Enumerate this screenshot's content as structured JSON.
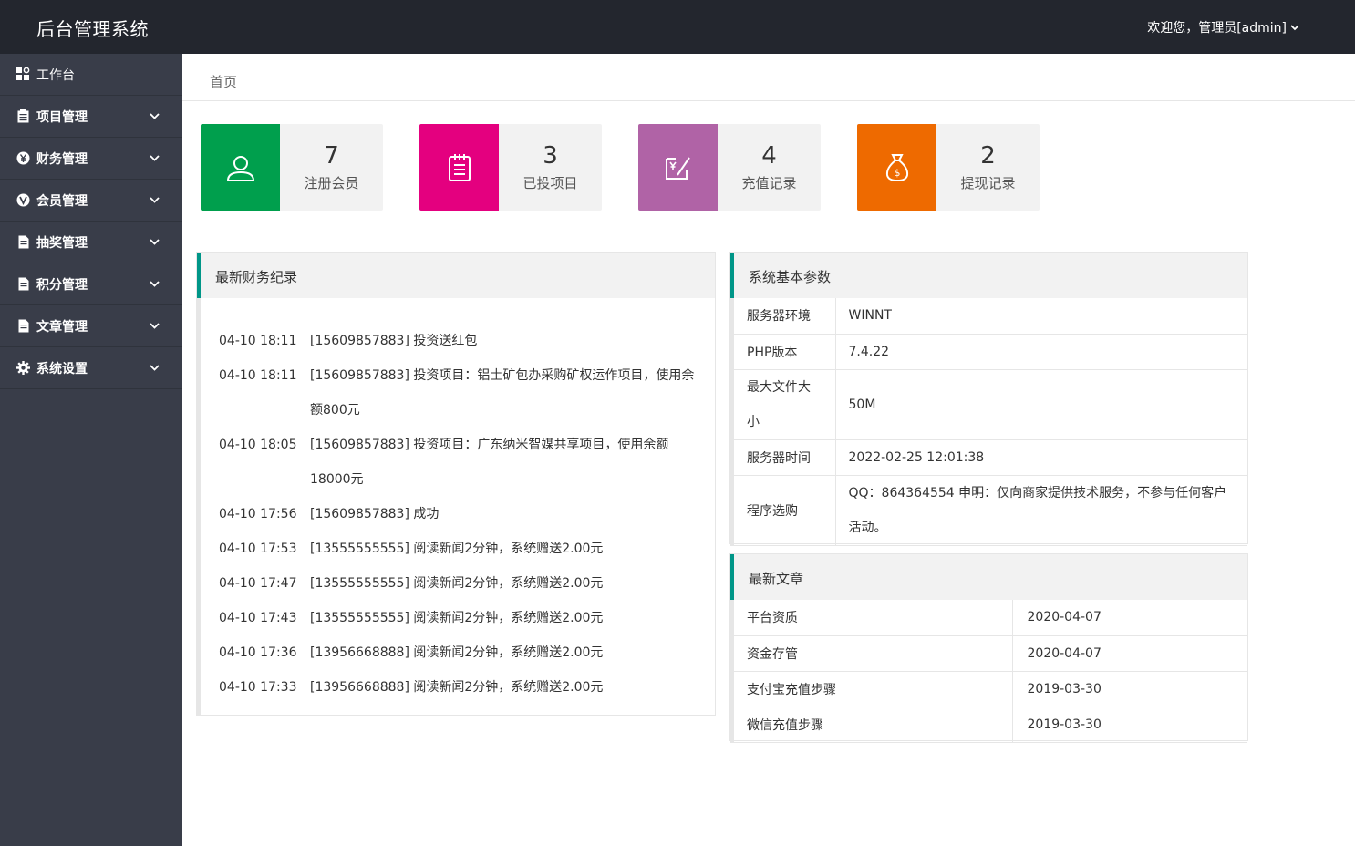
{
  "app": {
    "title": "后台管理系统",
    "user_menu_label": "欢迎您，管理员[admin]"
  },
  "sidebar": {
    "items": [
      {
        "label": "工作台",
        "icon": "dashboard-icon"
      },
      {
        "label": "项目管理",
        "icon": "clipboard-icon"
      },
      {
        "label": "财务管理",
        "icon": "yen-icon"
      },
      {
        "label": "会员管理",
        "icon": "member-v-icon"
      },
      {
        "label": "抽奖管理",
        "icon": "document-icon"
      },
      {
        "label": "积分管理",
        "icon": "document-icon"
      },
      {
        "label": "文章管理",
        "icon": "document-icon"
      },
      {
        "label": "系统设置",
        "icon": "gear-icon"
      }
    ]
  },
  "breadcrumb": "首页",
  "stats": [
    {
      "value": "7",
      "label": "注册会员",
      "color": "#009f4d",
      "icon": "user-icon"
    },
    {
      "value": "3",
      "label": "已投项目",
      "color": "#e4007f",
      "icon": "notepad-icon"
    },
    {
      "value": "4",
      "label": "充值记录",
      "color": "#b063a6",
      "icon": "recharge-icon"
    },
    {
      "value": "2",
      "label": "提现记录",
      "color": "#ee6a00",
      "icon": "money-bag-icon"
    }
  ],
  "finance": {
    "title": "最新财务纪录",
    "rows": [
      {
        "time": "04-10 18:11",
        "text": "[15609857883] 投资送红包"
      },
      {
        "time": "04-10 18:11",
        "text": "[15609857883] 投资项目：铝土矿包办采购矿权运作项目，使用余额800元"
      },
      {
        "time": "04-10 18:05",
        "text": "[15609857883] 投资项目：广东纳米智媒共享项目，使用余额18000元"
      },
      {
        "time": "04-10 17:56",
        "text": "[15609857883] 成功"
      },
      {
        "time": "04-10 17:53",
        "text": "[13555555555] 阅读新闻2分钟，系统赠送2.00元"
      },
      {
        "time": "04-10 17:47",
        "text": "[13555555555] 阅读新闻2分钟，系统赠送2.00元"
      },
      {
        "time": "04-10 17:43",
        "text": "[13555555555] 阅读新闻2分钟，系统赠送2.00元"
      },
      {
        "time": "04-10 17:36",
        "text": "[13956668888] 阅读新闻2分钟，系统赠送2.00元"
      },
      {
        "time": "04-10 17:33",
        "text": "[13956668888] 阅读新闻2分钟，系统赠送2.00元"
      }
    ]
  },
  "params": {
    "title": "系统基本参数",
    "rows": [
      {
        "key": "服务器环境",
        "value": "WINNT"
      },
      {
        "key": "PHP版本",
        "value": "7.4.22"
      },
      {
        "key": "最大文件大小",
        "value": "50M"
      },
      {
        "key": "服务器时间",
        "value": "2022-02-25 12:01:38"
      },
      {
        "key": "程序选购",
        "value": "QQ：864364554 申明：仅向商家提供技术服务，不参与任何客户活动。"
      }
    ]
  },
  "articles": {
    "title": "最新文章",
    "rows": [
      {
        "title": "平台资质",
        "date": "2020-04-07"
      },
      {
        "title": "资金存管",
        "date": "2020-04-07"
      },
      {
        "title": "支付宝充值步骤",
        "date": "2019-03-30"
      },
      {
        "title": "微信充值步骤",
        "date": "2019-03-30"
      }
    ]
  },
  "colors": {
    "topbar": "#23262e",
    "sidebar": "#393d49",
    "accent": "#009688"
  }
}
